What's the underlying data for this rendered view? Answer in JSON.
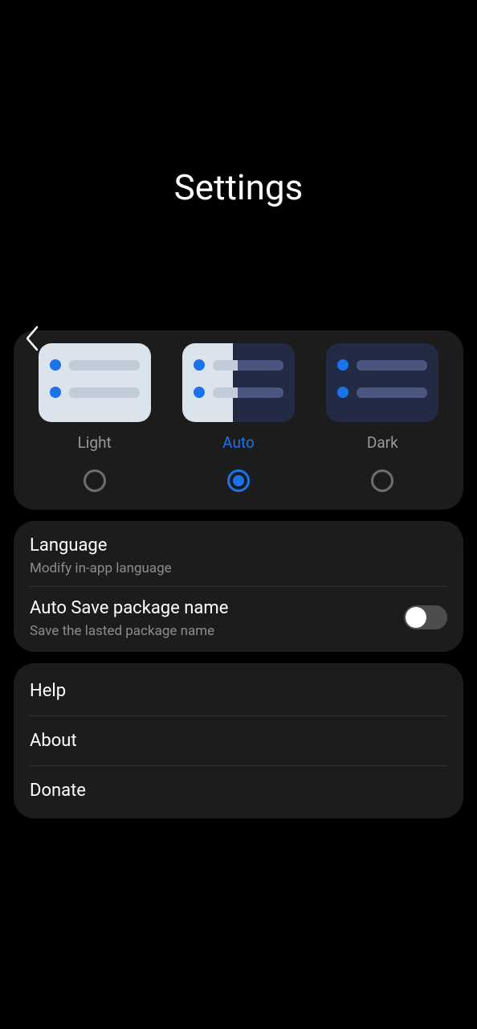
{
  "header": {
    "title": "Settings"
  },
  "theme": {
    "options": [
      {
        "label": "Light",
        "selected": false
      },
      {
        "label": "Auto",
        "selected": true
      },
      {
        "label": "Dark",
        "selected": false
      }
    ]
  },
  "settings_list": {
    "language": {
      "title": "Language",
      "subtitle": "Modify in-app language"
    },
    "autosave": {
      "title": "Auto Save package name",
      "subtitle": "Save the lasted package name",
      "enabled": false
    }
  },
  "links": {
    "help": "Help",
    "about": "About",
    "donate": "Donate"
  }
}
